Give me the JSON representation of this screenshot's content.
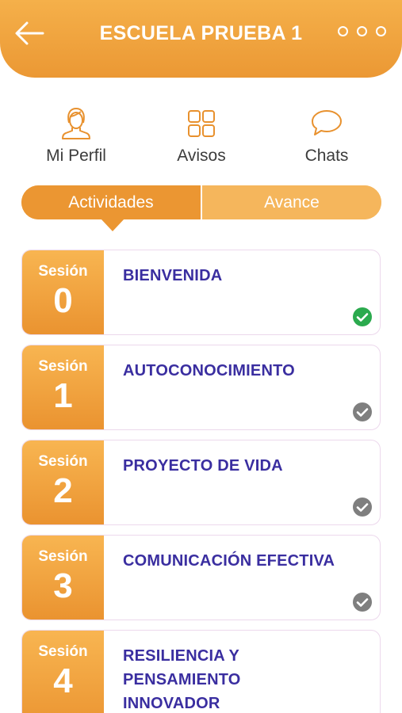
{
  "header": {
    "title": "ESCUELA PRUEBA 1"
  },
  "nav": {
    "profile_label": "Mi Perfil",
    "notices_label": "Avisos",
    "chats_label": "Chats"
  },
  "tabs": {
    "activities_label": "Actividades",
    "progress_label": "Avance",
    "active": "Actividades"
  },
  "colors": {
    "accent": "#EB9834",
    "accent_light": "#F5B65C",
    "title_text": "#3A2EA0",
    "complete_green": "#2BAA4E",
    "check_gray": "#7F7F7F"
  },
  "sessions": [
    {
      "label": "Sesión",
      "number": "0",
      "title": "BIENVENIDA",
      "status": "completed",
      "status_icon": "check-circle-green"
    },
    {
      "label": "Sesión",
      "number": "1",
      "title": "AUTOCONOCIMIENTO",
      "status": "pending",
      "status_icon": "check-circle-gray"
    },
    {
      "label": "Sesión",
      "number": "2",
      "title": "PROYECTO DE VIDA",
      "status": "pending",
      "status_icon": "check-circle-gray"
    },
    {
      "label": "Sesión",
      "number": "3",
      "title": "COMUNICACIÓN EFECTIVA",
      "status": "pending",
      "status_icon": "check-circle-gray"
    },
    {
      "label": "Sesión",
      "number": "4",
      "title": "RESILIENCIA Y PENSAMIENTO INNOVADOR",
      "status": "pending",
      "status_icon": "check-circle-gray"
    }
  ]
}
